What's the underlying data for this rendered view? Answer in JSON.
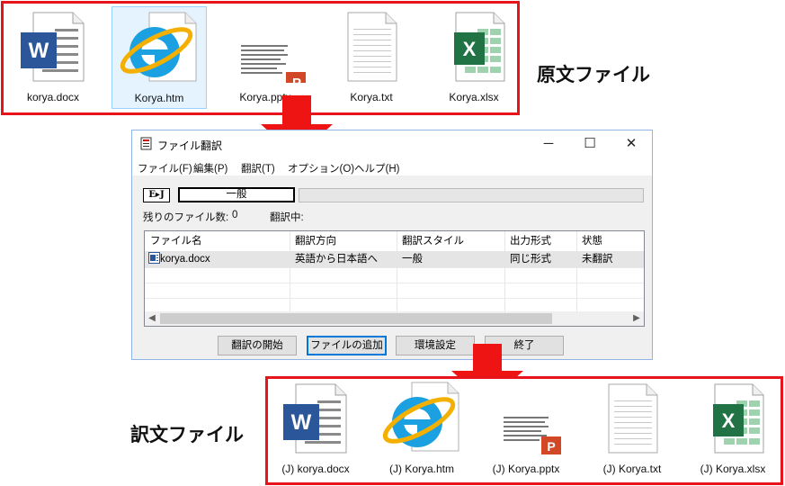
{
  "source_section": {
    "label": "原文ファイル",
    "files": [
      {
        "name": "korya.docx",
        "icon": "word-document-icon"
      },
      {
        "name": "Korya.htm",
        "icon": "internet-explorer-icon"
      },
      {
        "name": "Korya.pptx",
        "icon": "powerpoint-icon"
      },
      {
        "name": "Korya.txt",
        "icon": "text-file-icon"
      },
      {
        "name": "Korya.xlsx",
        "icon": "excel-icon"
      }
    ]
  },
  "target_section": {
    "label": "訳文ファイル",
    "files": [
      {
        "name": "(J) korya.docx",
        "icon": "word-document-icon"
      },
      {
        "name": "(J) Korya.htm",
        "icon": "internet-explorer-icon"
      },
      {
        "name": "(J) Korya.pptx",
        "icon": "powerpoint-icon"
      },
      {
        "name": "(J) Korya.txt",
        "icon": "text-file-icon"
      },
      {
        "name": "(J) Korya.xlsx",
        "icon": "excel-icon"
      }
    ]
  },
  "window": {
    "title": "ファイル翻訳",
    "caption_buttons": {
      "minimize": "─",
      "maximize": "☐",
      "close": "✕"
    },
    "menu": [
      "ファイル(F)",
      "編集(P)",
      "翻訳(T)",
      "オプション(O)",
      "ヘルプ(H)"
    ],
    "ej_badge": "E▸J",
    "mode": "一般",
    "remaining_label": "残りのファイル数:",
    "remaining_count": "0",
    "translating_label": "翻訳中:",
    "table": {
      "columns": [
        "ファイル名",
        "翻訳方向",
        "翻訳スタイル",
        "出力形式",
        "状態"
      ],
      "rows": [
        {
          "file": "korya.docx",
          "direction": "英語から日本語へ",
          "style": "一般",
          "output": "同じ形式",
          "status": "未翻訳"
        }
      ]
    },
    "buttons": {
      "start": "翻訳の開始",
      "add_file": "ファイルの追加",
      "settings": "環境設定",
      "exit": "終了"
    }
  },
  "colors": {
    "box_border": "#e8141b",
    "arrow": "#ef1414",
    "word_blue": "#2b579a",
    "excel_green": "#217346",
    "ppt_orange": "#d24726",
    "ie_blue": "#1ba1e2",
    "ie_gold": "#f4b000"
  }
}
